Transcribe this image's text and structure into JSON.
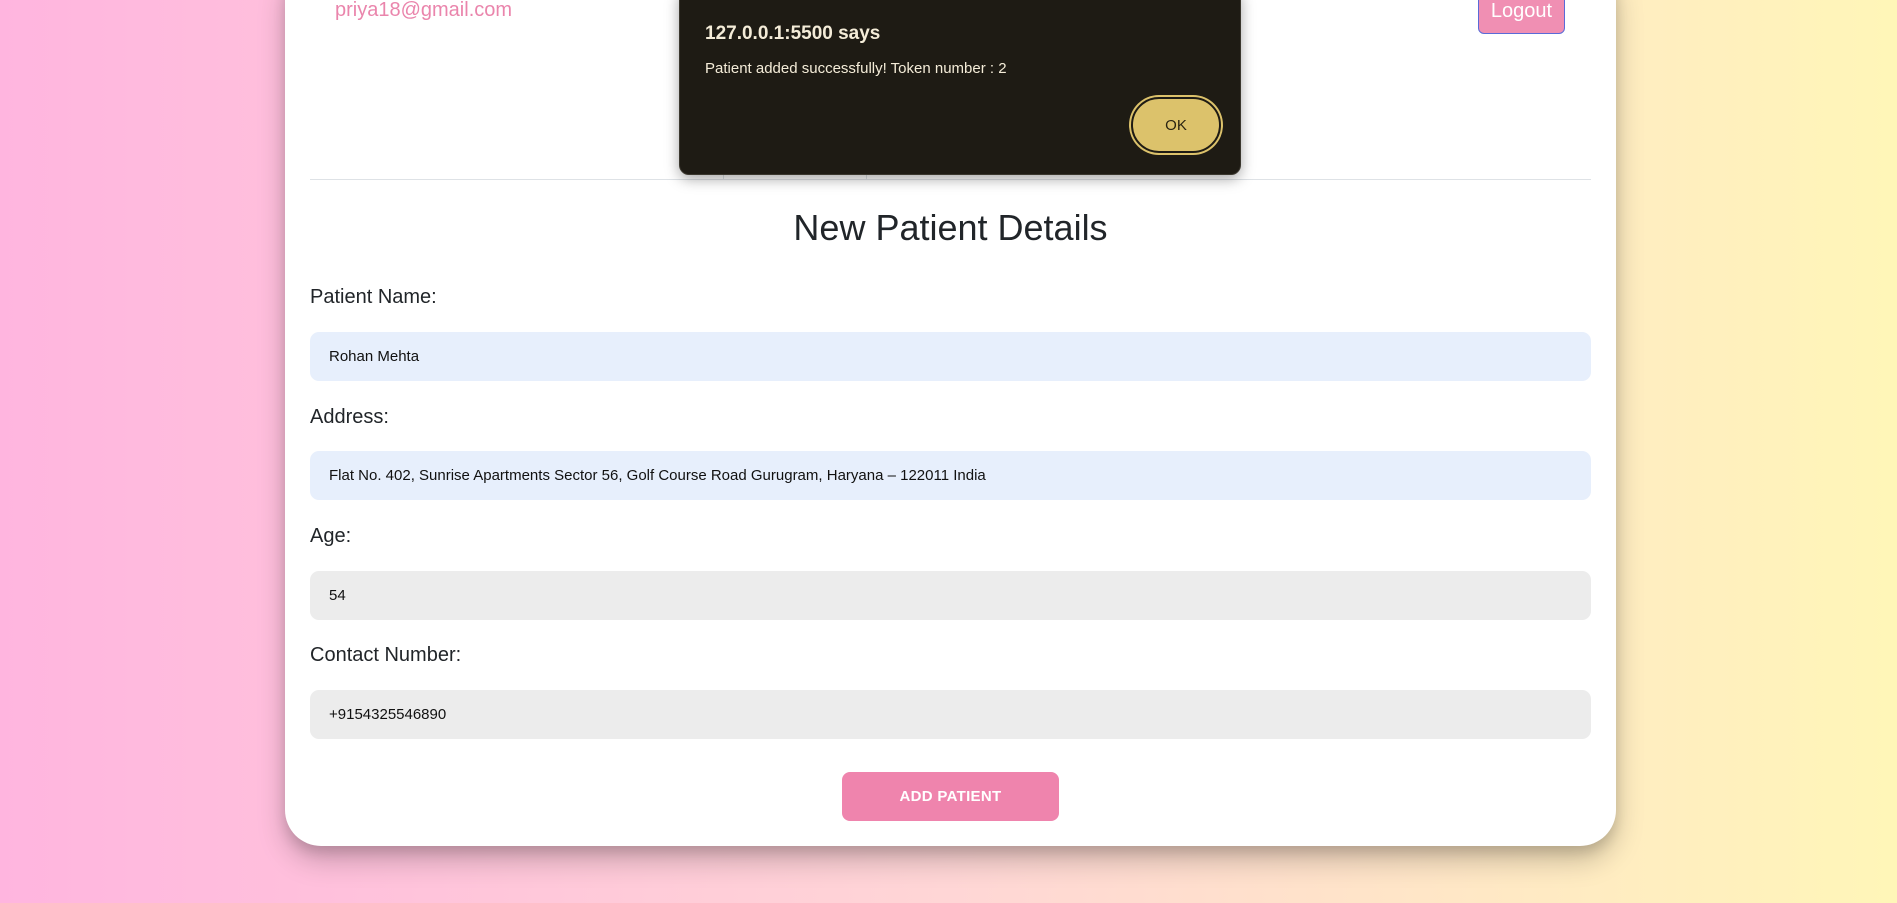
{
  "header": {
    "user_email": "priya18@gmail.com",
    "logout_label": "Logout"
  },
  "form": {
    "title": "New Patient Details",
    "patient_name": {
      "label": "Patient Name:",
      "value": "Rohan Mehta"
    },
    "address": {
      "label": "Address:",
      "value": "Flat No. 402, Sunrise Apartments Sector 56, Golf Course Road Gurugram, Haryana – 122011 India"
    },
    "age": {
      "label": "Age:",
      "value": "54"
    },
    "contact": {
      "label": "Contact Number:",
      "value": "+9154325546890"
    },
    "submit_label": "ADD PATIENT"
  },
  "alert": {
    "title": "127.0.0.1:5500 says",
    "message": "Patient added successfully! Token number : 2",
    "ok_label": "OK"
  },
  "colors": {
    "accent_pink": "#ef84ad",
    "autofill_blue": "#e7effc",
    "dialog_bg": "#1e1b14",
    "ok_gold": "#dcc26b"
  }
}
